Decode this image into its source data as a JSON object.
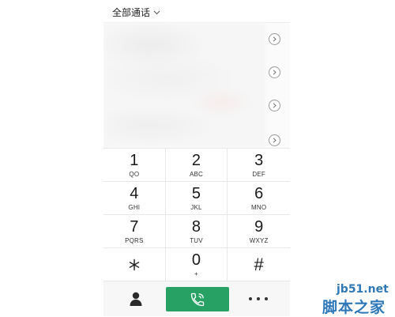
{
  "header": {
    "title": "全部通话"
  },
  "call_list": {
    "detail_button_count": 4
  },
  "keypad": [
    {
      "digit": "1",
      "letters": "QO"
    },
    {
      "digit": "2",
      "letters": "ABC"
    },
    {
      "digit": "3",
      "letters": "DEF"
    },
    {
      "digit": "4",
      "letters": "GHI"
    },
    {
      "digit": "5",
      "letters": "JKL"
    },
    {
      "digit": "6",
      "letters": "MNO"
    },
    {
      "digit": "7",
      "letters": "PQRS"
    },
    {
      "digit": "8",
      "letters": "TUV"
    },
    {
      "digit": "9",
      "letters": "WXYZ"
    },
    {
      "digit": "*",
      "letters": ""
    },
    {
      "digit": "0",
      "letters": "+"
    },
    {
      "digit": "#",
      "letters": ""
    }
  ],
  "bottom_bar": {
    "contacts_icon": "person-icon",
    "call_icon": "phone-handset-icon",
    "call_color": "#27a264",
    "more_icon": "ellipsis-icon"
  },
  "watermark": {
    "url": "jb51.net",
    "name": "脚本之家"
  }
}
